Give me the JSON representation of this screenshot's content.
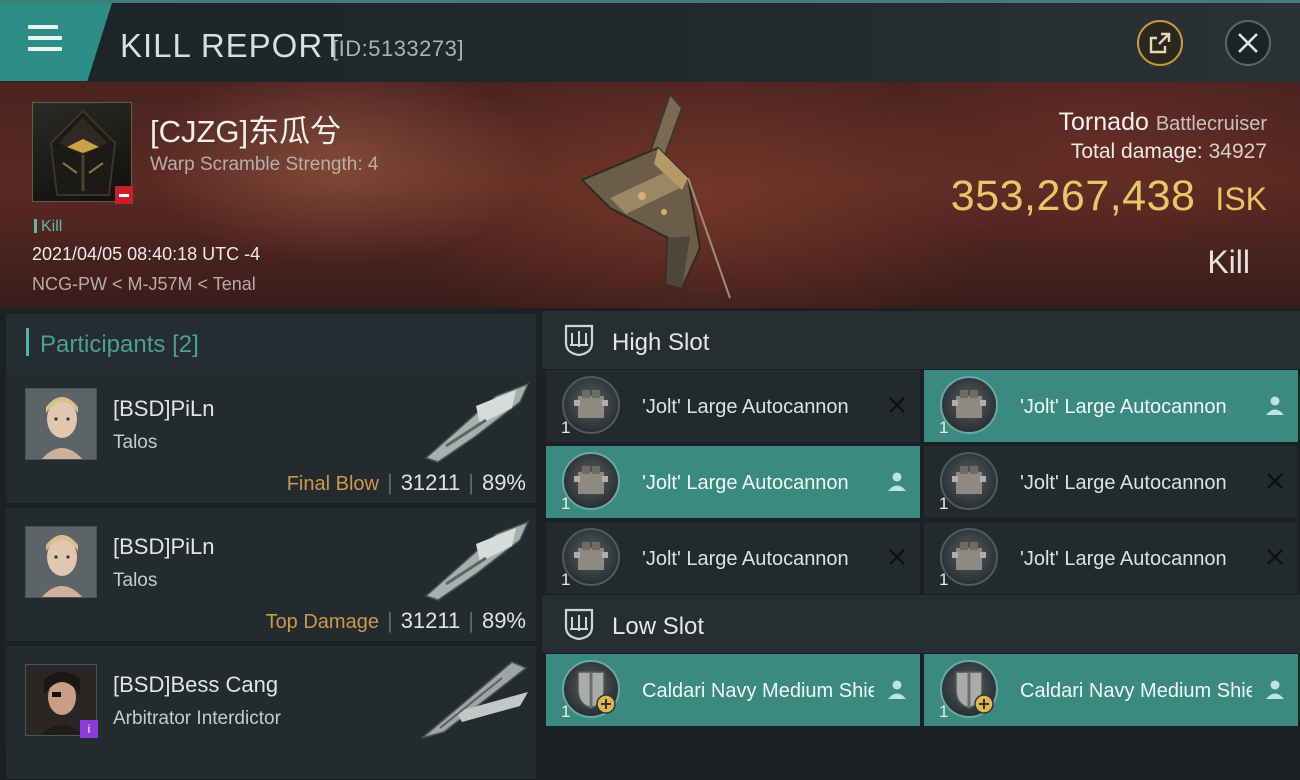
{
  "header": {
    "title": "KILL REPORT",
    "report_id": "[ID:5133273]"
  },
  "victim": {
    "name": "[CJZG]东瓜兮",
    "warp_scramble": "Warp Scramble Strength: 4",
    "tag": "Kill",
    "datetime": "2021/04/05 08:40:18 UTC -4",
    "location": "NCG-PW < M-J57M < Tenal"
  },
  "ship": {
    "name": "Tornado",
    "class": "Battlecruiser",
    "total_damage_label": "Total damage:",
    "total_damage": "34927",
    "isk_value": "353,267,438",
    "isk_unit": "ISK",
    "result": "Kill"
  },
  "participants": {
    "title": "Participants",
    "count": "[2]",
    "rows": [
      {
        "name": "[BSD]PiLn",
        "ship": "Talos",
        "label": "Final Blow",
        "damage": "31211",
        "percent": "89%"
      },
      {
        "name": "[BSD]PiLn",
        "ship": "Talos",
        "label": "Top Damage",
        "damage": "31211",
        "percent": "89%"
      },
      {
        "name": "[BSD]Bess Cang",
        "ship": "Arbitrator Interdictor"
      }
    ]
  },
  "slots": {
    "high": {
      "title": "High Slot",
      "modules": [
        {
          "name": "'Jolt' Large Autocannon",
          "qty": "1",
          "status": "destroyed"
        },
        {
          "name": "'Jolt' Large Autocannon",
          "qty": "1",
          "status": "dropped"
        },
        {
          "name": "'Jolt' Large Autocannon",
          "qty": "1",
          "status": "dropped"
        },
        {
          "name": "'Jolt' Large Autocannon",
          "qty": "1",
          "status": "destroyed"
        },
        {
          "name": "'Jolt' Large Autocannon",
          "qty": "1",
          "status": "destroyed"
        },
        {
          "name": "'Jolt' Large Autocannon",
          "qty": "1",
          "status": "destroyed"
        }
      ]
    },
    "low": {
      "title": "Low Slot",
      "modules": [
        {
          "name": "Caldari Navy Medium Shield ...",
          "qty": "1",
          "status": "dropped"
        },
        {
          "name": "Caldari Navy Medium Shield ...",
          "qty": "1",
          "status": "dropped"
        }
      ]
    }
  },
  "colors": {
    "accent": "#3a8a82",
    "isk": "#ebc56a",
    "label_gold": "#c99a4b",
    "corp_flag": "#c8202a"
  }
}
